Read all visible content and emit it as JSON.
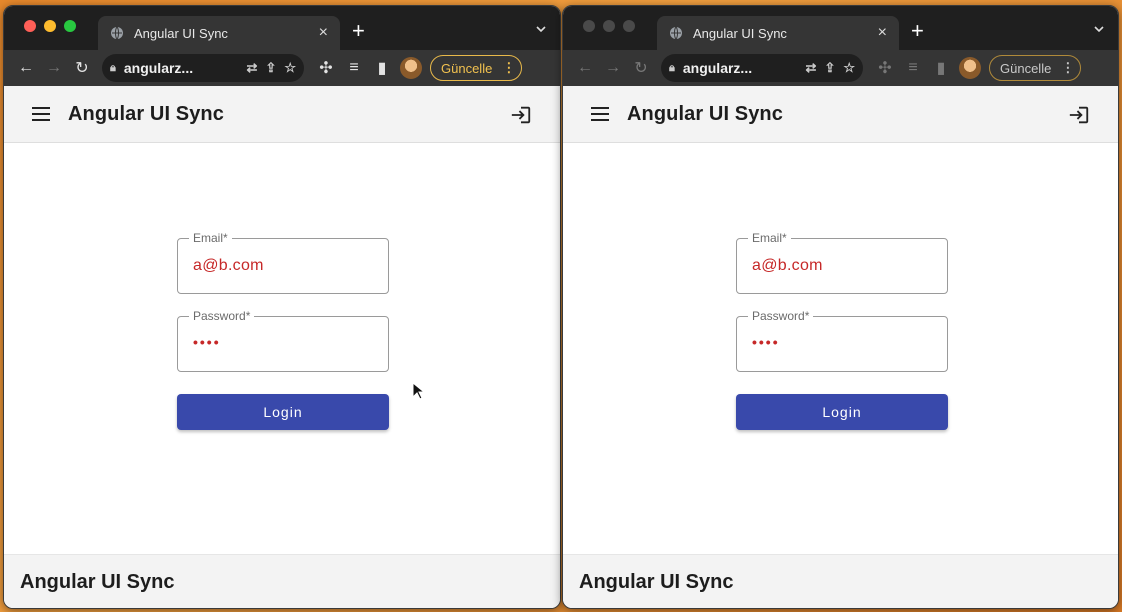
{
  "browser": {
    "tab_title": "Angular UI Sync",
    "url": "angularz...",
    "update_label": "Güncelle",
    "new_tab_label": "+",
    "close_tab_label": "×"
  },
  "app": {
    "title": "Angular UI Sync",
    "footer_title": "Angular UI Sync"
  },
  "form": {
    "email_label": "Email*",
    "email_value": "a@b.com",
    "password_label": "Password*",
    "password_value": "••••",
    "login_label": "Login"
  },
  "colors": {
    "primary": "#3949ab",
    "error_text": "#c62828",
    "update_badge": "#f1c14f"
  },
  "icons": [
    "globe-icon",
    "back-icon",
    "forward-icon",
    "reload-icon",
    "lock-icon",
    "translate-icon",
    "share-icon",
    "star-icon",
    "extensions-icon",
    "reading-list-icon",
    "side-panel-icon",
    "kebab-icon",
    "menu-icon",
    "login-icon"
  ]
}
